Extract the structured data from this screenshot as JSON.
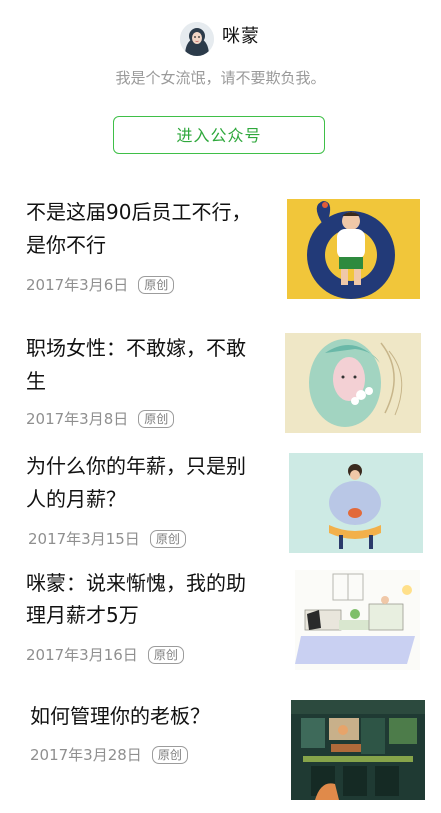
{
  "account": {
    "name": "咪蒙",
    "description": "我是个女流氓，请不要欺负我。",
    "follow_button": "进入公众号"
  },
  "articles": [
    {
      "title_lines": [
        "不是这届90后员工不行，",
        "是你不行"
      ],
      "date": "2017年3月6日",
      "badge": "原创",
      "thumb_icon": "inflatable-ring-illustration"
    },
    {
      "title_lines": [
        "职场女性：不敢嫁，不敢",
        "生"
      ],
      "date": "2017年3月8日",
      "badge": "原创",
      "thumb_icon": "woman-portrait-illustration"
    },
    {
      "title_lines": [
        "为什么你的年薪，只是别",
        "人的月薪？"
      ],
      "date": "2017年3月15日",
      "badge": "原创",
      "thumb_icon": "person-sitting-illustration"
    },
    {
      "title_lines": [
        "咪蒙：说来惭愧，我的助",
        "理月薪才5万"
      ],
      "date": "2017年3月16日",
      "badge": "原创",
      "thumb_icon": "living-room-illustration"
    },
    {
      "title_lines": [
        "如何管理你的老板？"
      ],
      "date": "2017年3月28日",
      "badge": "原创",
      "thumb_icon": "office-scene-illustration"
    }
  ],
  "colors": {
    "accent_green": "#2fa83c",
    "muted_text": "#8f8f8f"
  }
}
